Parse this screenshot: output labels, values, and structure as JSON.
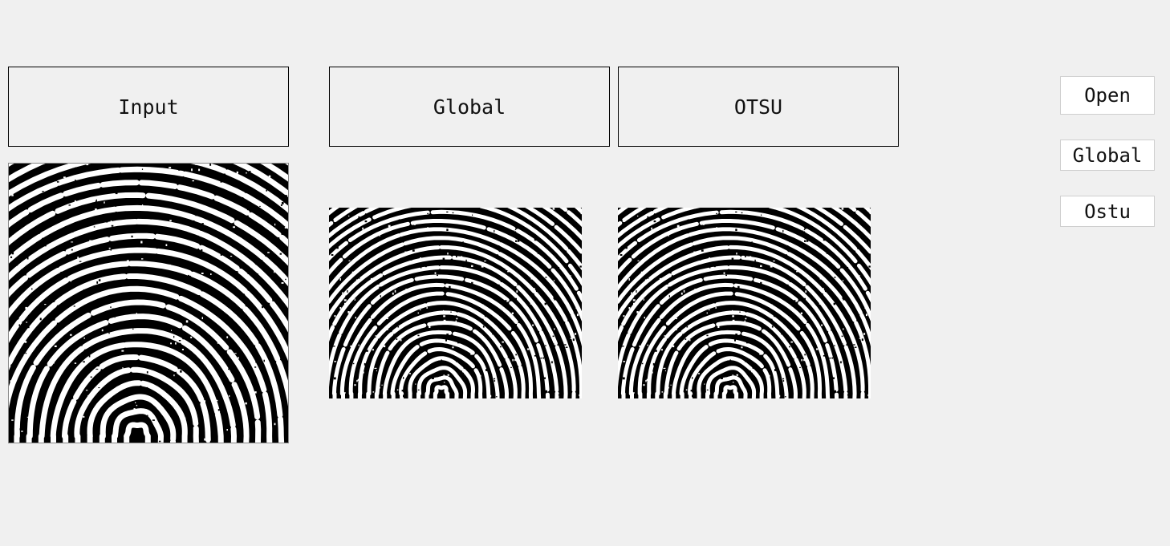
{
  "labels": {
    "input": "Input",
    "global": "Global",
    "otsu": "OTSU"
  },
  "buttons": {
    "open": "Open",
    "global": "Global",
    "ostu": "Ostu"
  },
  "colors": {
    "window_bg": "#f0f0f0",
    "image_bg": "#000000",
    "ridge": "#ffffff"
  }
}
